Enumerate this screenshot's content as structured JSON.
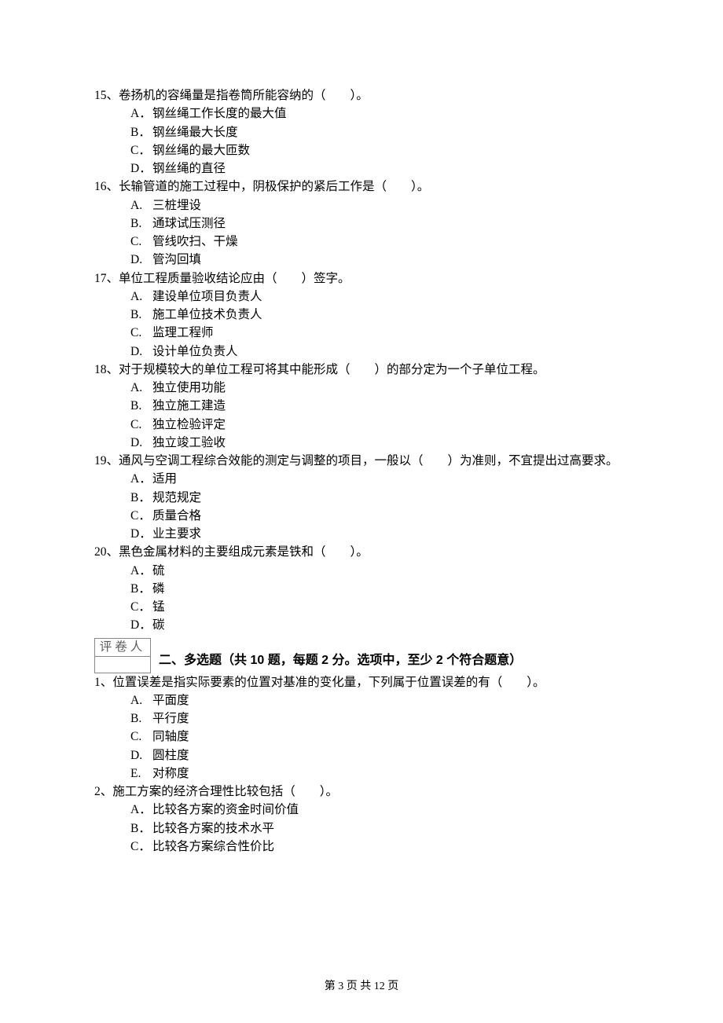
{
  "questions": [
    {
      "num": "15、",
      "stem": "卷扬机的容绳量是指卷筒所能容纳的（　　）。",
      "opts": [
        {
          "l": "A．",
          "t": "钢丝绳工作长度的最大值"
        },
        {
          "l": "B．",
          "t": "钢丝绳最大长度"
        },
        {
          "l": "C．",
          "t": "钢丝绳的最大匝数"
        },
        {
          "l": "D．",
          "t": "钢丝绳的直径"
        }
      ]
    },
    {
      "num": "16、",
      "stem": "长输管道的施工过程中，阴极保护的紧后工作是（　　）。",
      "opts": [
        {
          "l": "A.",
          "t": "三桩埋设"
        },
        {
          "l": "B.",
          "t": "通球试压测径"
        },
        {
          "l": "C.",
          "t": "管线吹扫、干燥"
        },
        {
          "l": "D.",
          "t": "管沟回填"
        }
      ]
    },
    {
      "num": "17、",
      "stem": "单位工程质量验收结论应由（　　）签字。",
      "opts": [
        {
          "l": "A.",
          "t": "建设单位项目负责人"
        },
        {
          "l": "B.",
          "t": "施工单位技术负责人"
        },
        {
          "l": "C.",
          "t": "监理工程师"
        },
        {
          "l": "D.",
          "t": "设计单位负责人"
        }
      ]
    },
    {
      "num": "18、",
      "stem": "对于规模较大的单位工程可将其中能形成（　　）的部分定为一个子单位工程。",
      "opts": [
        {
          "l": "A.",
          "t": "独立使用功能"
        },
        {
          "l": "B.",
          "t": "独立施工建造"
        },
        {
          "l": "C.",
          "t": "独立检验评定"
        },
        {
          "l": "D.",
          "t": "独立竣工验收"
        }
      ]
    },
    {
      "num": "19、",
      "stem": "通风与空调工程综合效能的测定与调整的项目，一般以（　　）为准则，不宜提出过高要求。",
      "opts": [
        {
          "l": "A．",
          "t": "适用"
        },
        {
          "l": "B．",
          "t": "规范规定"
        },
        {
          "l": "C．",
          "t": "质量合格"
        },
        {
          "l": "D．",
          "t": "业主要求"
        }
      ]
    },
    {
      "num": "20、",
      "stem": "黑色金属材料的主要组成元素是铁和（　　）。",
      "opts": [
        {
          "l": "A．",
          "t": "硫"
        },
        {
          "l": "B．",
          "t": "磷"
        },
        {
          "l": "C．",
          "t": "锰"
        },
        {
          "l": "D．",
          "t": "碳"
        }
      ]
    }
  ],
  "grader_label": "评卷人",
  "section2_title": "二、多选题（共 10 题，每题 2 分。选项中，至少 2 个符合题意）",
  "mquestions": [
    {
      "num": "1、",
      "stem": "位置误差是指实际要素的位置对基准的变化量，下列属于位置误差的有（　　）。",
      "opts": [
        {
          "l": "A.",
          "t": "平面度"
        },
        {
          "l": "B.",
          "t": "平行度"
        },
        {
          "l": "C.",
          "t": "同轴度"
        },
        {
          "l": "D.",
          "t": "圆柱度"
        },
        {
          "l": "E.",
          "t": "对称度"
        }
      ]
    },
    {
      "num": "2、",
      "stem": "施工方案的经济合理性比较包括（　　）。",
      "opts": [
        {
          "l": "A．",
          "t": "比较各方案的资金时间价值"
        },
        {
          "l": "B．",
          "t": "比较各方案的技术水平"
        },
        {
          "l": "C．",
          "t": "比较各方案综合性价比"
        }
      ]
    }
  ],
  "footer": "第 3 页 共 12 页"
}
